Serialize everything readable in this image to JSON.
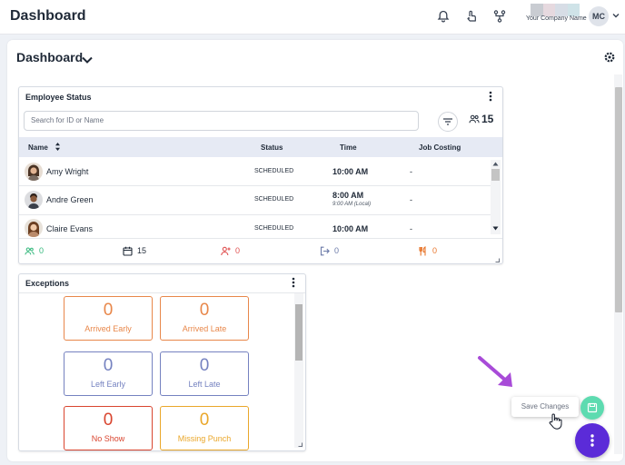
{
  "app": {
    "title": "Dashboard",
    "company_name": "Your Company Name",
    "user_initials": "MC"
  },
  "dashboard": {
    "title": "Dashboard"
  },
  "employee_status": {
    "title": "Employee Status",
    "search_placeholder": "Search for ID or Name",
    "count": "15",
    "columns": [
      "Name",
      "Status",
      "Time",
      "Job Costing"
    ],
    "rows": [
      {
        "name": "Amy Wright",
        "status": "SCHEDULED",
        "time": "10:00 AM",
        "sub": "",
        "job": "-"
      },
      {
        "name": "Andre Green",
        "status": "SCHEDULED",
        "time": "8:00 AM",
        "sub": "9:00 AM (Local)",
        "job": "-"
      },
      {
        "name": "Claire Evans",
        "status": "SCHEDULED",
        "time": "10:00 AM",
        "sub": "",
        "job": "-"
      }
    ],
    "footer": [
      {
        "icon": "users-icon",
        "value": "0",
        "color": "#34b87c"
      },
      {
        "icon": "calendar-icon",
        "value": "15",
        "color": "#1f2937"
      },
      {
        "icon": "user-plus-icon",
        "value": "0",
        "color": "#e05252"
      },
      {
        "icon": "logout-icon",
        "value": "0",
        "color": "#6b7aa8"
      },
      {
        "icon": "fork-knife-icon",
        "value": "0",
        "color": "#e8762c"
      }
    ]
  },
  "exceptions": {
    "title": "Exceptions",
    "tiles": [
      {
        "value": "0",
        "label": "Arrived Early",
        "color": "#e8874a"
      },
      {
        "value": "0",
        "label": "Arrived Late",
        "color": "#e8874a"
      },
      {
        "value": "0",
        "label": "Left Early",
        "color": "#7582c0"
      },
      {
        "value": "0",
        "label": "Left Late",
        "color": "#7582c0"
      },
      {
        "value": "0",
        "label": "No Show",
        "color": "#d9452f"
      },
      {
        "value": "0",
        "label": "Missing Punch",
        "color": "#eaa72a"
      }
    ]
  },
  "floating": {
    "save_label": "Save Changes"
  },
  "colors": {
    "accent": "#5b2bd8",
    "save": "#5ddbb0",
    "annotation": "#a84bd8"
  }
}
